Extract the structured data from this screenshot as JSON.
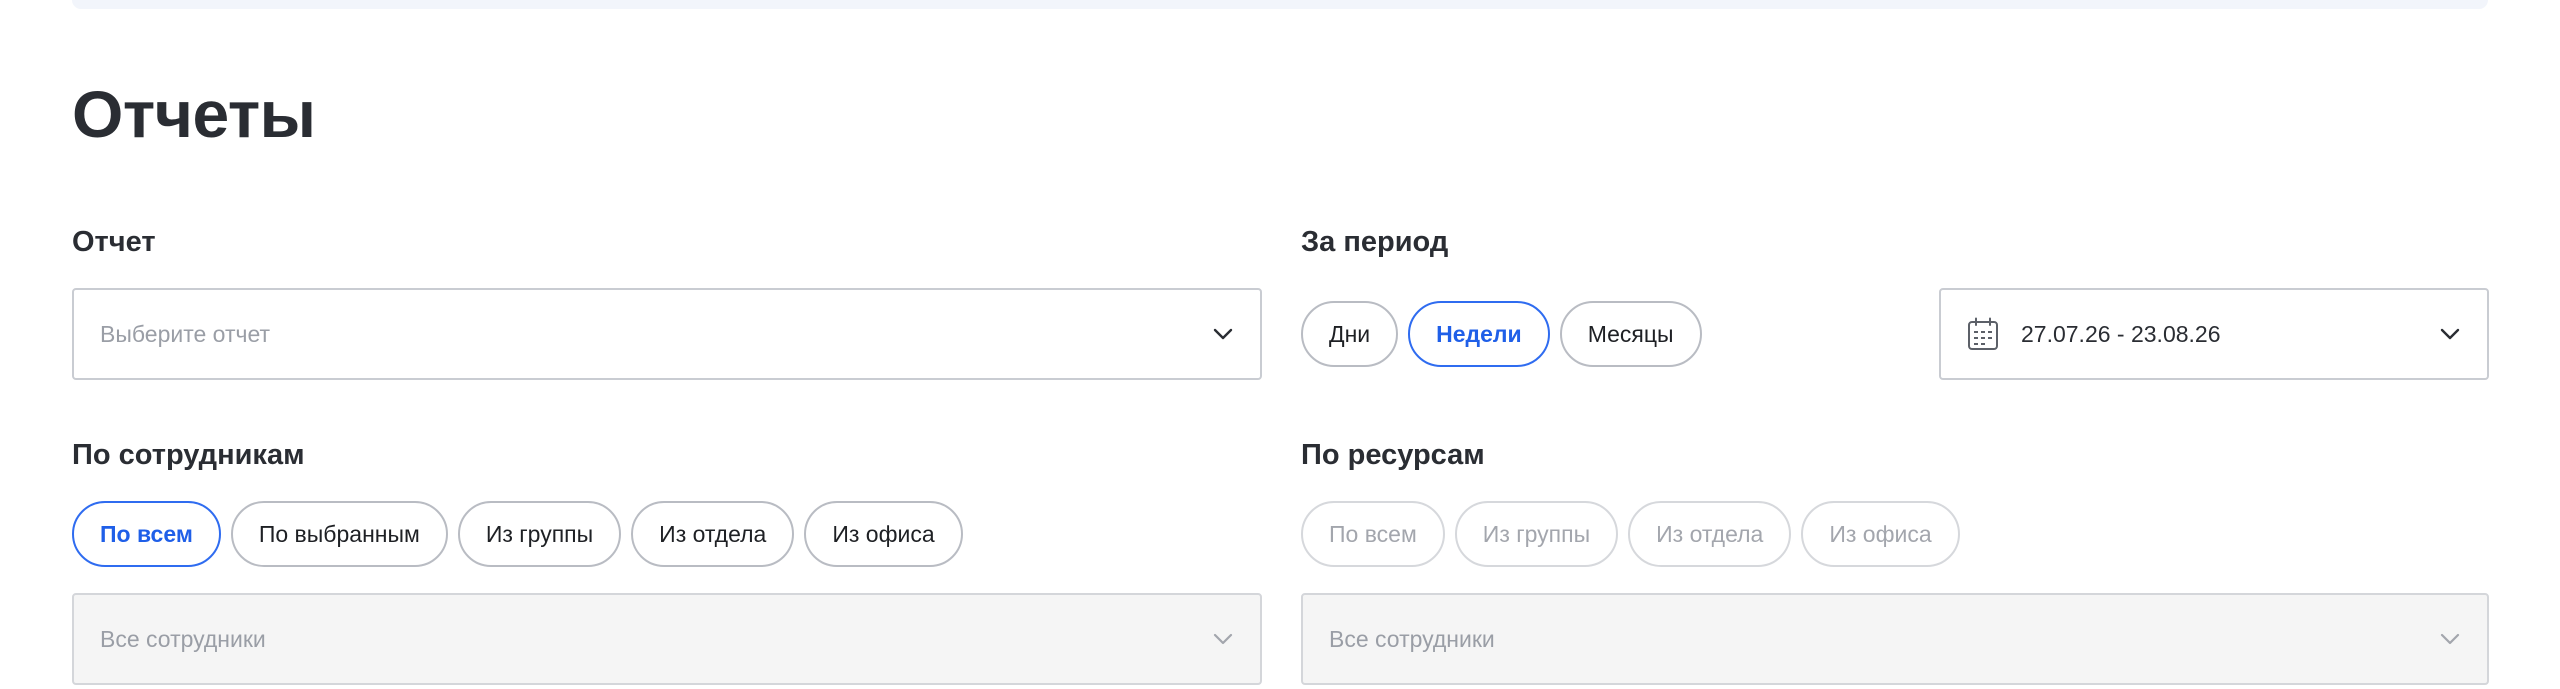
{
  "page": {
    "title": "Отчеты"
  },
  "report": {
    "label": "Отчет",
    "select_placeholder": "Выберите отчет"
  },
  "period": {
    "label": "За период",
    "options": [
      "Дни",
      "Недели",
      "Месяцы"
    ],
    "selected": "Недели",
    "date_range": "27.07.26 - 23.08.26"
  },
  "employees": {
    "label": "По сотрудникам",
    "options": [
      "По всем",
      "По выбранным",
      "Из группы",
      "Из отдела",
      "Из офиса"
    ],
    "selected": "По всем",
    "select_placeholder": "Все сотрудники"
  },
  "resources": {
    "label": "По ресурсам",
    "options": [
      "По всем",
      "Из группы",
      "Из отдела",
      "Из офиса"
    ],
    "select_placeholder": "Все сотрудники"
  },
  "colors": {
    "accent": "#1f5fe8",
    "text": "#2a2d33",
    "placeholder": "#9a9ea6",
    "border": "#c9ccd2",
    "disabled_bg": "#f5f5f5"
  }
}
